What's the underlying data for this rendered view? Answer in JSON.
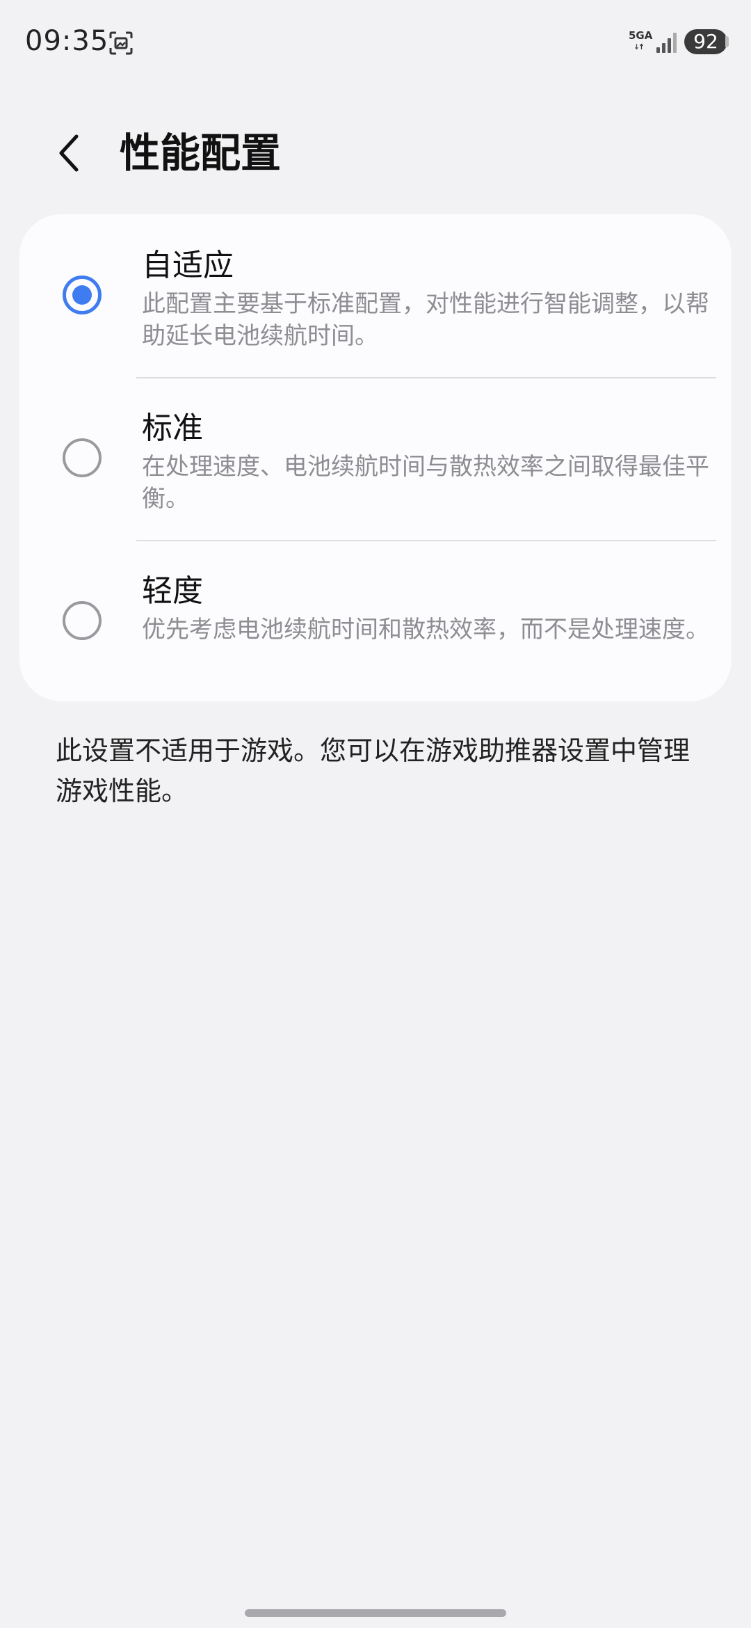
{
  "status_bar": {
    "time": "09:35",
    "network": "5GA",
    "battery": "92",
    "screenshot_icon": "screenshot-icon",
    "signal_icon": "signal-icon"
  },
  "header": {
    "back_icon": "chevron-left-icon",
    "title": "性能配置"
  },
  "options": [
    {
      "title": "自适应",
      "description": "此配置主要基于标准配置，对性能进行智能调整，以帮助延长电池续航时间。",
      "selected": true
    },
    {
      "title": "标准",
      "description": "在处理速度、电池续航时间与散热效率之间取得最佳平衡。",
      "selected": false
    },
    {
      "title": "轻度",
      "description": "优先考虑电池续航时间和散热效率，而不是处理速度。",
      "selected": false
    }
  ],
  "footnote": "此设置不适用于游戏。您可以在游戏助推器设置中管理游戏性能。",
  "colors": {
    "accent": "#3e7cf0",
    "background": "#f2f2f4",
    "card": "#fcfcfe",
    "secondary_text": "#8d8d92"
  }
}
